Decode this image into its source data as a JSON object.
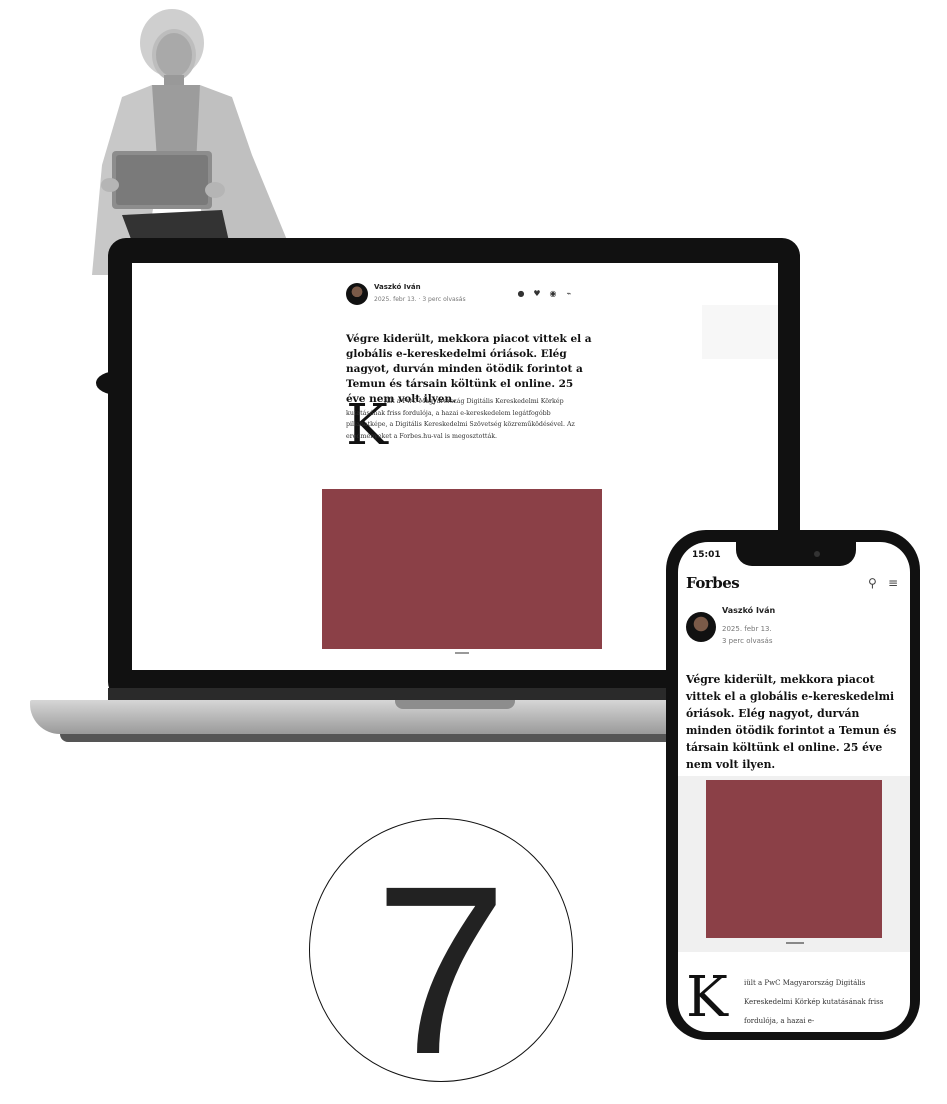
{
  "laptop": {
    "author": "Vaszkó Iván",
    "meta": "2025. febr 13. · 3 perc olvasás",
    "share_icons": [
      "facebook-icon",
      "twitter-icon",
      "email-icon",
      "link-icon"
    ],
    "headline": "Végre kiderült, mekkora piacot vittek el a globális e-kereskedelmi óriások. Elég nagyot, durván minden ötödik forintot a Temun és társain költünk el online. 25 éve nem volt ilyen.",
    "dropcap": "K",
    "lead": "iült a PwC Magyarország Digitális Kereskedelmi Körkép kutatásának friss fordulója, a hazai e-kereskedelem legátfogóbb pillanatképe, a Digitális Kereskedelmi Szövetség közreműködésével. Az eredményeket a Forbes.hu-val is megosztották.",
    "image_color": "#8b4047"
  },
  "phone": {
    "time": "15:01",
    "logo": "Forbes",
    "author": "Vaszkó Iván",
    "date": "2025. febr 13.",
    "read_time": "3 perc olvasás",
    "headline": "Végre kiderült, mekkora piacot vittek el a globális e-kereskedelmi óriások. Elég nagyot, durván minden ötödik forintot a Temun és társain költünk el online. 25 éve nem volt ilyen.",
    "dropcap": "K",
    "lead": "iült a PwC Magyarország Digitális Kereskedelmi Körkép kutatásának friss fordulója, a hazai e-",
    "image_color": "#8b4047"
  },
  "badge": {
    "number": "7"
  }
}
